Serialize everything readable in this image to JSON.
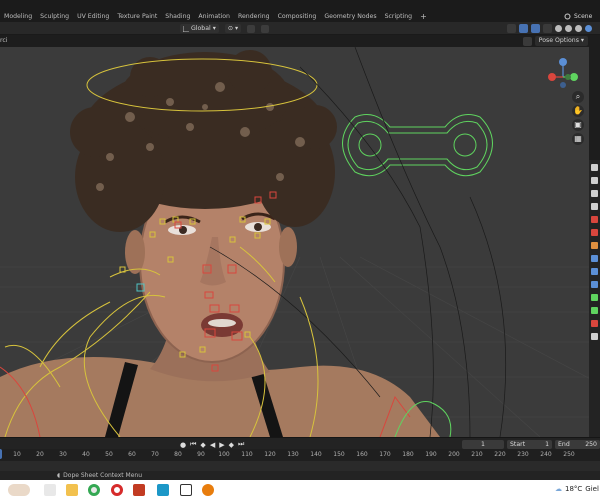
{
  "workspace_tabs": [
    "Modeling",
    "Sculpting",
    "UV Editing",
    "Texture Paint",
    "Shading",
    "Animation",
    "Rendering",
    "Compositing",
    "Geometry Nodes",
    "Scripting"
  ],
  "workspace_add": "+",
  "scene": {
    "label": "Scene"
  },
  "header": {
    "transform_orientation": "Global",
    "left_text": "rci"
  },
  "pose_options": "Pose Options",
  "timeline": {
    "current_frame": "1",
    "start_label": "Start",
    "start_value": "1",
    "end_label": "End",
    "end_value": "250",
    "playhead": "1",
    "ruler": [
      "10",
      "20",
      "30",
      "40",
      "50",
      "60",
      "70",
      "80",
      "90",
      "100",
      "110",
      "120",
      "130",
      "140",
      "150",
      "160",
      "170",
      "180",
      "190",
      "200",
      "210",
      "220",
      "230",
      "240",
      "250"
    ]
  },
  "status": {
    "message": "Dope Sheet Context Menu"
  },
  "taskbar": {
    "icons": [
      "folder-icon",
      "chrome-icon",
      "opera-icon",
      "office-icon",
      "media-icon",
      "c-app-icon",
      "cube-app-icon",
      "blender-icon"
    ],
    "weather_temp": "18°C",
    "weather_text": "Giel"
  },
  "colors": {
    "accent": "#4772b3",
    "bone_green": "#5fd35f",
    "bone_yellow": "#d7c33c",
    "bone_red": "#d9463d"
  }
}
